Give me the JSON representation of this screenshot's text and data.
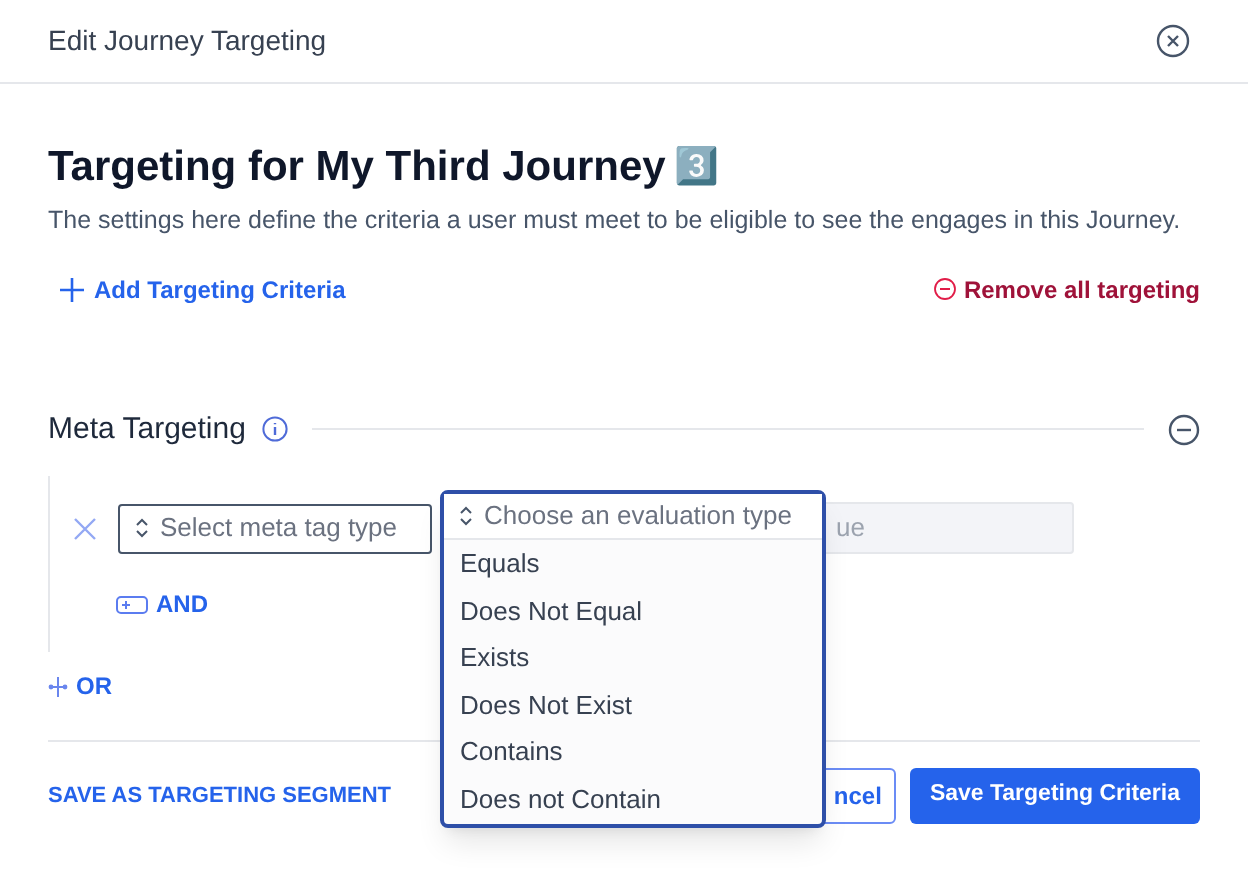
{
  "window": {
    "title": "Edit Journey Targeting"
  },
  "heading": {
    "title": "Targeting for My Third Journey",
    "emoji": "3️⃣",
    "description": "The settings here define the criteria a user must meet to be eligible to see the engages in this Journey."
  },
  "actions": {
    "add": "Add Targeting Criteria",
    "remove": "Remove all targeting"
  },
  "section": {
    "title": "Meta Targeting"
  },
  "criterion": {
    "meta_tag": {
      "placeholder": "Select meta tag type"
    },
    "evaluation": {
      "placeholder": "Choose an evaluation type",
      "expanded": true
    },
    "value": {
      "placeholder": "ue"
    },
    "and": "AND"
  },
  "dropdown_options": [
    {
      "label": "Equals",
      "selected": false
    },
    {
      "label": "Does Not Equal",
      "selected": false
    },
    {
      "label": "Exists",
      "selected": false
    },
    {
      "label": "Does Not Exist",
      "selected": false
    },
    {
      "label": "Contains",
      "selected": false
    },
    {
      "label": "Does not Contain",
      "selected": false
    }
  ],
  "or": "OR",
  "footer": {
    "segment": "SAVE AS TARGETING SEGMENT",
    "cancel": "ncel",
    "save": "Save Targeting Criteria"
  }
}
